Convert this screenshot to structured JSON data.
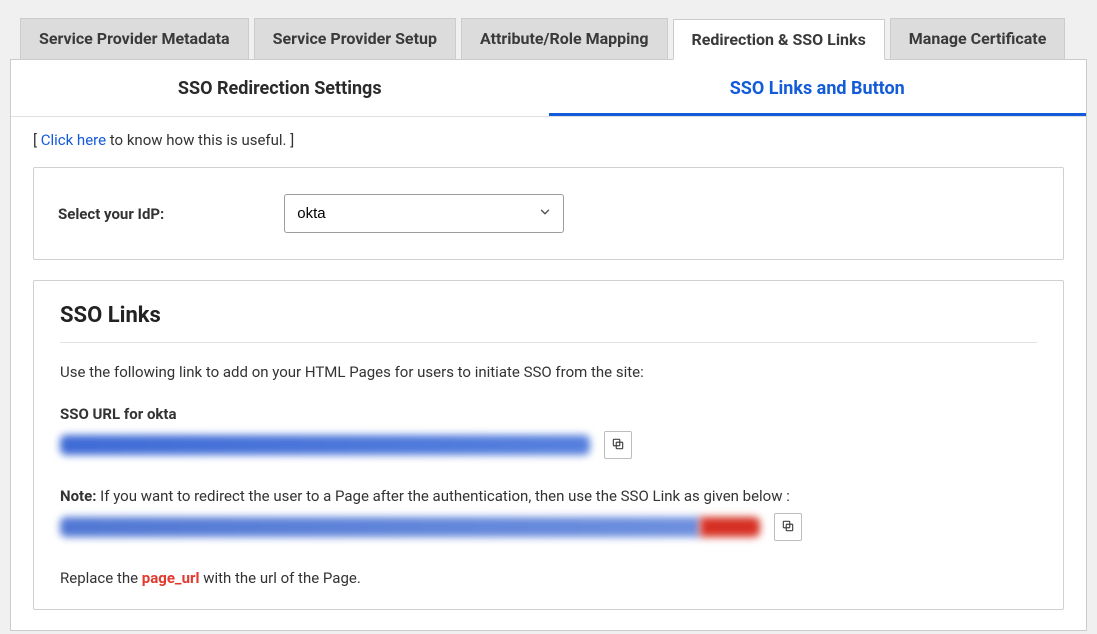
{
  "primary_tabs": {
    "t0": "Service Provider Metadata",
    "t1": "Service Provider Setup",
    "t2": "Attribute/Role Mapping",
    "t3": "Redirection & SSO Links",
    "t4": "Manage Certificate"
  },
  "sub_tabs": {
    "s0": "SSO Redirection Settings",
    "s1": "SSO Links and Button"
  },
  "hint": {
    "open_bracket": "[ ",
    "link": "Click here",
    "rest": " to know how this is useful. ]"
  },
  "idp": {
    "label": "Select your IdP:",
    "selected": "okta"
  },
  "sso_links": {
    "title": "SSO Links",
    "description": "Use the following link to add on your HTML Pages for users to initiate SSO from the site:",
    "url_label": "SSO URL for okta",
    "note_prefix": "Note:",
    "note_rest": " If you want to redirect the user to a Page after the authentication, then use the SSO Link as given below :",
    "replace_prefix": "Replace the ",
    "replace_token": "page_url",
    "replace_suffix": " with the url of the Page."
  }
}
